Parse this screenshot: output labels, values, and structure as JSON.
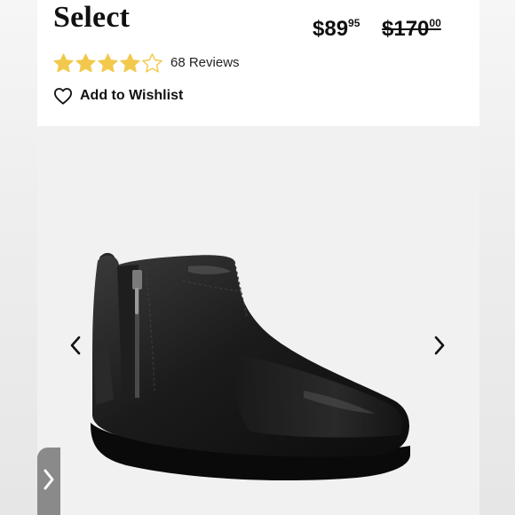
{
  "product": {
    "title": "Select",
    "price": {
      "sale_dollars": "$89",
      "sale_cents": "95",
      "original_dollars": "$170",
      "original_cents": "00"
    },
    "rating": {
      "value": 4,
      "max": 5,
      "reviews_label": "68 Reviews",
      "star_color": "#f2c94c"
    },
    "wishlist_label": "Add to Wishlist"
  },
  "gallery": {
    "image": "black-leather-ankle-boot",
    "prev_icon": "chevron-left-icon",
    "next_icon": "chevron-right-icon"
  },
  "edge_tab": {
    "icon": "chevron-right-icon"
  }
}
